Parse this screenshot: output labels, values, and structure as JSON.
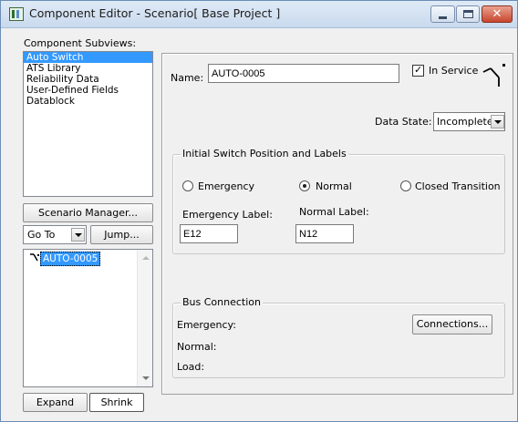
{
  "window": {
    "title": "Component Editor  - Scenario[ Base Project ]",
    "close_glyph": "✕"
  },
  "left": {
    "subviews_label": "Component Subviews:",
    "subviews": [
      "Auto Switch",
      "ATS Library",
      "Reliability Data",
      "User-Defined Fields",
      "Datablock"
    ],
    "scenario_manager_label": "Scenario Manager...",
    "goto_value": "Go To",
    "jump_label": "Jump...",
    "tree_items": [
      {
        "label": "AUTO-0005",
        "icon": "switch-icon"
      }
    ],
    "expand_label": "Expand",
    "shrink_label": "Shrink"
  },
  "main": {
    "name_label": "Name:",
    "name_value": "AUTO-0005",
    "in_service_label": "In Service",
    "in_service_checked": true,
    "data_state_label": "Data State:",
    "data_state_value": "Incomplete",
    "switch_group_title": "Initial Switch Position and Labels",
    "radio_options": [
      {
        "label": "Emergency",
        "selected": false
      },
      {
        "label": "Normal",
        "selected": true
      },
      {
        "label": "Closed Transition",
        "selected": false
      }
    ],
    "emergency_label_caption": "Emergency Label:",
    "emergency_label_value": "E12",
    "normal_label_caption": "Normal Label:",
    "normal_label_value": "N12",
    "bus_group_title": "Bus Connection",
    "bus_rows": [
      "Emergency:",
      "Normal:",
      "Load:"
    ],
    "connections_label": "Connections..."
  },
  "colors": {
    "selection": "#3399ff",
    "window_bg": "#f0f0f0",
    "close_button": "#c8452d"
  }
}
